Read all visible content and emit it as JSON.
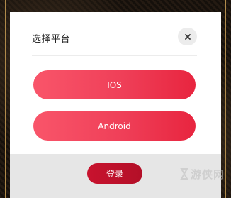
{
  "dialog": {
    "title": "选择平台",
    "close_icon": "close-icon"
  },
  "platforms": [
    {
      "label": "IOS"
    },
    {
      "label": "Android"
    }
  ],
  "footer": {
    "login_label": "登录"
  },
  "watermark": {
    "text": "游侠网"
  },
  "colors": {
    "platform_button_start": "#f9556a",
    "platform_button_end": "#e8253f",
    "login_button": "#c8132e",
    "frame_gold": "#b08a4a",
    "footer_bg": "#e6e6e6"
  }
}
